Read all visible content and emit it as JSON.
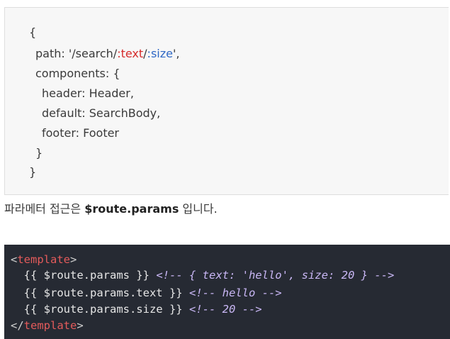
{
  "route_config": {
    "lines": {
      "l1": "{",
      "l2_pre": "path: '/search/",
      "l2_red": ":text",
      "l2_mid": "/",
      "l2_blue": ":size",
      "l2_post": "',",
      "l3": "components: {",
      "l4": "header: Header,",
      "l5": "default: SearchBody,",
      "l6": "footer: Footer",
      "l7": "}",
      "l8": "}"
    }
  },
  "description": {
    "prefix": "파라메터 접근은 ",
    "bold": "$route.params",
    "suffix": " 입니다."
  },
  "template_code": {
    "open_tag": "template",
    "close_tag": "template",
    "line1_expr": "{{ $route.params }}",
    "line1_comment": "<!-- { text: 'hello', size: 20 } -->",
    "line2_expr": "{{ $route.params.text }}",
    "line2_comment": "<!-- hello -->",
    "line3_expr": "{{ $route.params.size }}",
    "line3_comment": "<!-- 20 -->"
  },
  "colors": {
    "code_bg": "#262a33",
    "tag": "#e45b5b",
    "comment": "#c9b7f5",
    "param_text": "#d52b2b",
    "param_size": "#2f68c5"
  }
}
